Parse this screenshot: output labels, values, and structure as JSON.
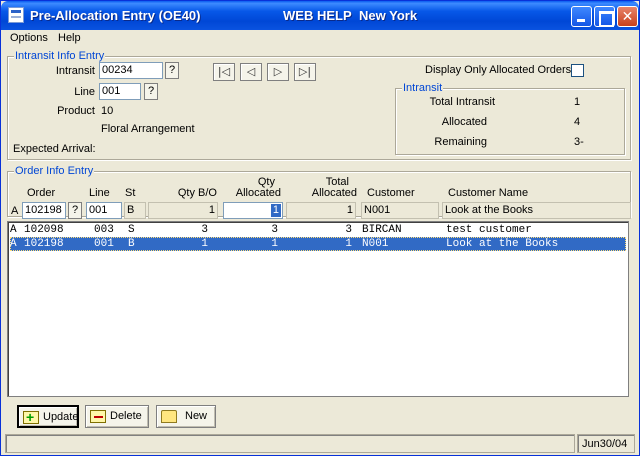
{
  "window": {
    "title": "Pre-Allocation Entry (OE40)",
    "help_label": "WEB HELP",
    "location": "New York"
  },
  "menu": {
    "options": "Options",
    "help": "Help"
  },
  "intransit_info": {
    "group_label": "Intransit Info Entry",
    "intransit_label": "Intransit",
    "intransit_value": "00234",
    "line_label": "Line",
    "line_value": "001",
    "product_label": "Product",
    "product_value": "10",
    "product_desc": "Floral Arrangement",
    "expected_arrival_label": "Expected Arrival:",
    "lookup_label": "?",
    "display_only_label": "Display Only Allocated Orders"
  },
  "intransit_summary": {
    "group_label": "Intransit",
    "total_label": "Total Intransit",
    "total_value": "1",
    "allocated_label": "Allocated",
    "allocated_value": "4",
    "remaining_label": "Remaining",
    "remaining_value": "3-"
  },
  "order_info": {
    "group_label": "Order Info Entry",
    "headers": {
      "order": "Order",
      "line": "Line",
      "st": "St",
      "qty_bo": "Qty B/O",
      "qty_allocated_1": "Qty",
      "qty_allocated_2": "Allocated",
      "total_allocated_1": "Total",
      "total_allocated_2": "Allocated",
      "customer": "Customer",
      "customer_name": "Customer Name"
    },
    "entry": {
      "prefix": "A",
      "order": "102198",
      "line": "001",
      "st": "B",
      "qty_bo": "1",
      "qty_allocated": "1",
      "total_allocated": "1",
      "customer": "N001",
      "customer_name": "Look at the Books"
    }
  },
  "grid": {
    "rows": [
      {
        "prefix": "A",
        "order": "102098",
        "line": "003",
        "st": "S",
        "qty_bo": "3",
        "qty_allocated": "3",
        "total_allocated": "3",
        "customer": "BIRCAN",
        "customer_name": "test customer"
      },
      {
        "prefix": "A",
        "order": "102198",
        "line": "001",
        "st": "B",
        "qty_bo": "1",
        "qty_allocated": "1",
        "total_allocated": "1",
        "customer": "N001",
        "customer_name": "Look at the Books"
      }
    ]
  },
  "buttons": {
    "update": "Update",
    "delete": "Delete",
    "new": "New"
  },
  "status": {
    "date": "Jun30/04"
  }
}
